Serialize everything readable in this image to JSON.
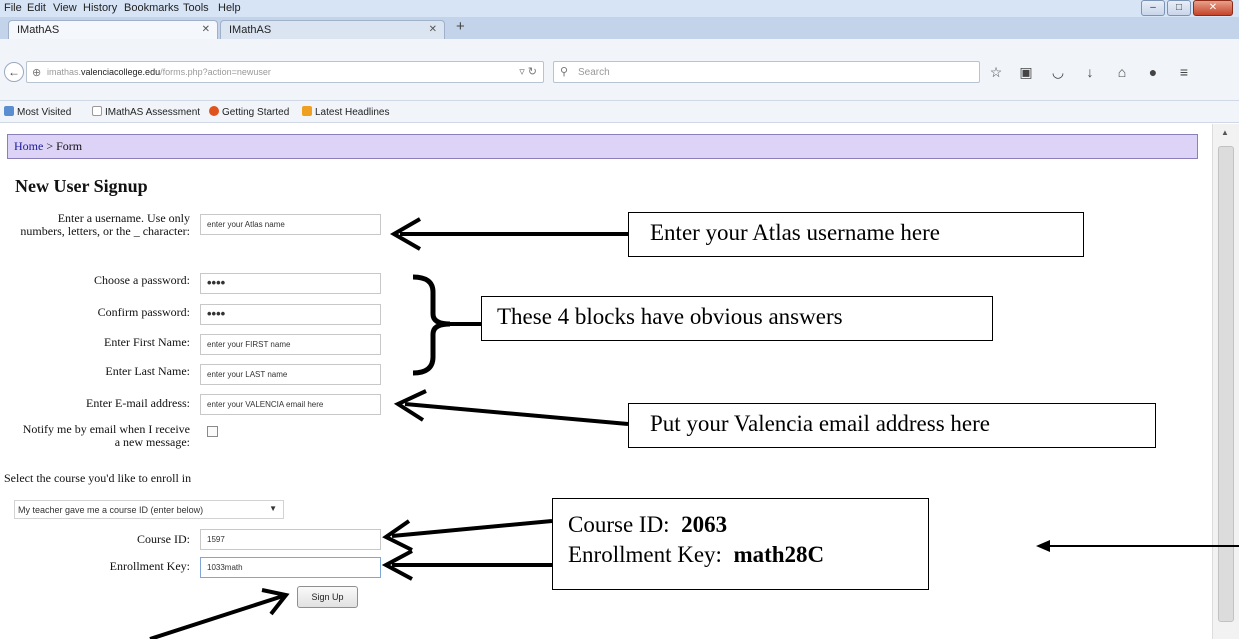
{
  "browser": {
    "menu": [
      "File",
      "Edit",
      "View",
      "History",
      "Bookmarks",
      "Tools",
      "Help"
    ],
    "window_controls": [
      "minimize",
      "maximize",
      "close"
    ],
    "tabs": [
      {
        "label": "IMathAS",
        "active": true
      },
      {
        "label": "IMathAS",
        "active": false
      }
    ],
    "url_prefix": "imathas.",
    "url_domain": "valenciacollege.edu",
    "url_path": "/forms.php?action=newuser",
    "search_placeholder": "Search",
    "bookmarks": [
      "Most Visited",
      "IMathAS Assessment",
      "Getting Started",
      "Latest Headlines"
    ]
  },
  "page": {
    "breadcrumb_home": "Home",
    "breadcrumb_sep": " > ",
    "breadcrumb_current": "Form",
    "title": "New User Signup",
    "form": {
      "username_label": "Enter a username. Use only numbers, letters, or the _ character:",
      "username_value": "enter your Atlas name",
      "password_label": "Choose a password:",
      "password_value": "••••",
      "confirm_label": "Confirm password:",
      "confirm_value": "••••",
      "first_name_label": "Enter First Name:",
      "first_name_value": "enter your FIRST name",
      "last_name_label": "Enter Last Name:",
      "last_name_value": "enter your LAST name",
      "email_label": "Enter E-mail address:",
      "email_value": "enter your VALENCIA email here",
      "notify_label": "Notify me by email when I receive a new message:",
      "notify_checked": false,
      "course_prompt": "Select the course you'd like to enroll in",
      "course_select_value": "My teacher gave me a course ID (enter below)",
      "course_id_label": "Course ID:",
      "course_id_value": "1597",
      "enroll_key_label": "Enrollment Key:",
      "enroll_key_value": "1033math",
      "submit_label": "Sign Up"
    }
  },
  "annotations": {
    "username_callout": "Enter your Atlas username here",
    "blocks_callout": "These 4 blocks have obvious answers",
    "email_callout": "Put your Valencia email address here",
    "course_id_prefix": "Course ID:",
    "course_id_value": "2063",
    "enroll_key_prefix": "Enrollment Key:",
    "enroll_key_value": "math28C"
  },
  "colors": {
    "breadcrumb_bg": "#dcd3f7",
    "breadcrumb_border": "#8a7fb8",
    "chrome_bg": "#f1f5fa",
    "link": "#1b1b99"
  }
}
